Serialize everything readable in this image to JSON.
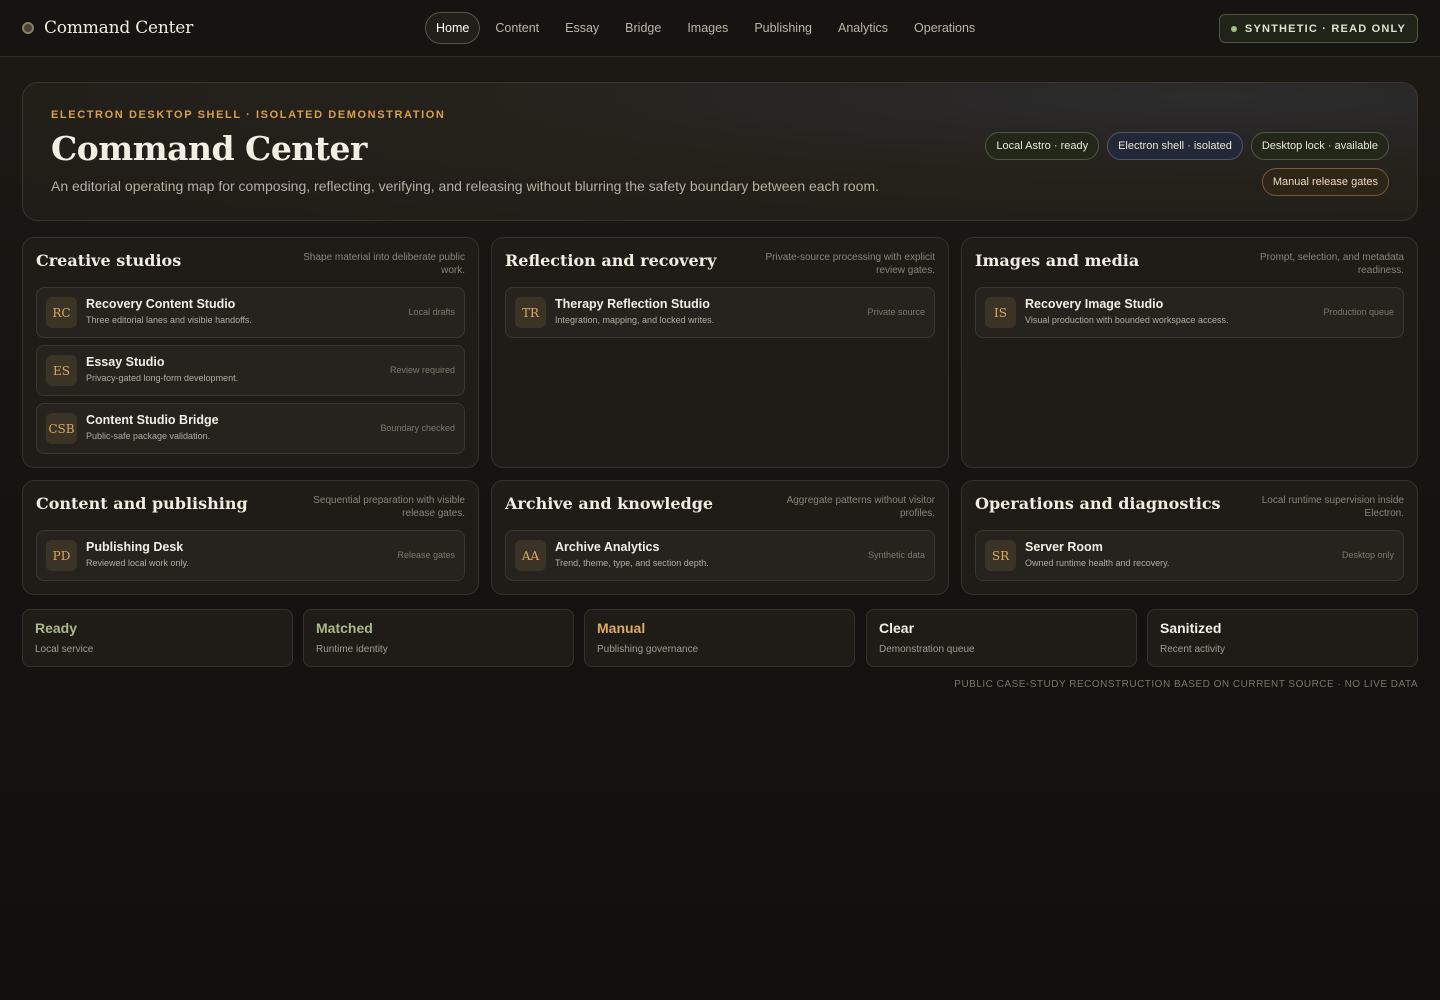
{
  "brand": {
    "name": "Command Center"
  },
  "nav": {
    "items": [
      {
        "label": "Home",
        "active": true
      },
      {
        "label": "Content"
      },
      {
        "label": "Essay"
      },
      {
        "label": "Bridge"
      },
      {
        "label": "Images"
      },
      {
        "label": "Publishing"
      },
      {
        "label": "Analytics"
      },
      {
        "label": "Operations"
      }
    ]
  },
  "status_pill": {
    "label": "SYNTHETIC · READ ONLY"
  },
  "hero": {
    "eyebrow": "ELECTRON DESKTOP SHELL · ISOLATED DEMONSTRATION",
    "title": "Command Center",
    "subtitle": "An editorial operating map for composing, reflecting, verifying, and releasing without blurring the safety boundary between each room.",
    "chips": [
      "Local Astro · ready",
      "Electron shell · isolated",
      "Desktop lock · available",
      "Manual release gates"
    ]
  },
  "panels": [
    {
      "title": "Creative studios",
      "desc": "Shape material into deliberate public work.",
      "cards": [
        {
          "badge": "RC",
          "name": "Recovery Content Studio",
          "sub": "Three editorial lanes and visible handoffs.",
          "tag": "Local drafts"
        },
        {
          "badge": "ES",
          "name": "Essay Studio",
          "sub": "Privacy-gated long-form development.",
          "tag": "Review required"
        },
        {
          "badge": "CSB",
          "name": "Content Studio Bridge",
          "sub": "Public-safe package validation.",
          "tag": "Boundary checked"
        }
      ]
    },
    {
      "title": "Reflection and recovery",
      "desc": "Private-source processing with explicit review gates.",
      "cards": [
        {
          "badge": "TR",
          "name": "Therapy Reflection Studio",
          "sub": "Integration, mapping, and locked writes.",
          "tag": "Private source"
        }
      ]
    },
    {
      "title": "Images and media",
      "desc": "Prompt, selection, and metadata readiness.",
      "cards": [
        {
          "badge": "IS",
          "name": "Recovery Image Studio",
          "sub": "Visual production with bounded workspace access.",
          "tag": "Production queue"
        }
      ]
    },
    {
      "title": "Content and publishing",
      "desc": "Sequential preparation with visible release gates.",
      "cards": [
        {
          "badge": "PD",
          "name": "Publishing Desk",
          "sub": "Reviewed local work only.",
          "tag": "Release gates"
        }
      ]
    },
    {
      "title": "Archive and knowledge",
      "desc": "Aggregate patterns without visitor profiles.",
      "cards": [
        {
          "badge": "AA",
          "name": "Archive Analytics",
          "sub": "Trend, theme, type, and section depth.",
          "tag": "Synthetic data"
        }
      ]
    },
    {
      "title": "Operations and diagnostics",
      "desc": "Local runtime supervision inside Electron.",
      "cards": [
        {
          "badge": "SR",
          "name": "Server Room",
          "sub": "Owned runtime health and recovery.",
          "tag": "Desktop only"
        }
      ]
    }
  ],
  "stats": [
    {
      "value": "Ready",
      "label": "Local service",
      "color": "#a8b98a"
    },
    {
      "value": "Matched",
      "label": "Runtime identity",
      "color": "#a8b98a"
    },
    {
      "value": "Manual",
      "label": "Publishing governance",
      "color": "#dcaa62"
    },
    {
      "value": "Clear",
      "label": "Demonstration queue",
      "color": "#f2eee4"
    },
    {
      "value": "Sanitized",
      "label": "Recent activity",
      "color": "#f2eee4"
    }
  ],
  "footer_note": "PUBLIC CASE-STUDY RECONSTRUCTION BASED ON CURRENT SOURCE · NO LIVE DATA",
  "icons": {
    "brand": "status-ring-icon",
    "status": "status-dot-icon"
  }
}
